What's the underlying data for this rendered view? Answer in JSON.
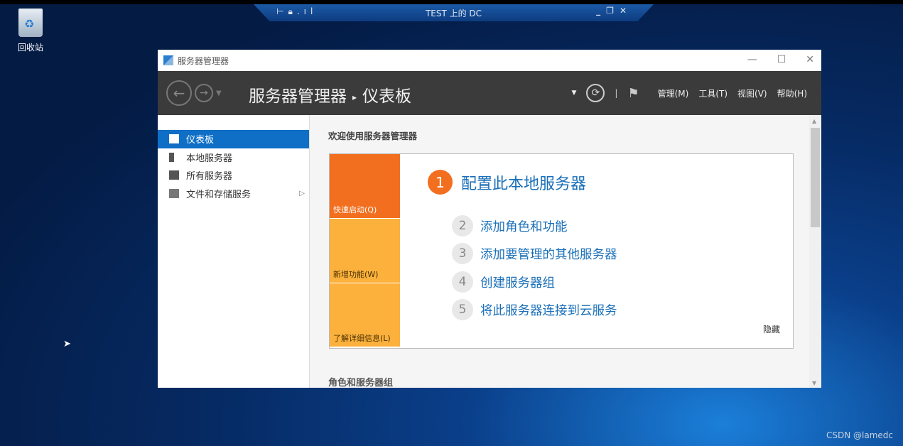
{
  "rdp_bar": {
    "title": "TEST 上的 DC",
    "left_icons": [
      "pin-icon",
      "lock-icon",
      "signal-icon"
    ],
    "right_icons": [
      "minimize-icon",
      "restore-icon",
      "close-icon"
    ]
  },
  "desktop": {
    "recycle_bin": "回收站",
    "watermark": "CSDN @lamedc"
  },
  "window": {
    "title": "服务器管理器",
    "breadcrumb": {
      "root": "服务器管理器",
      "current": "仪表板"
    },
    "menu": [
      "管理(M)",
      "工具(T)",
      "视图(V)",
      "帮助(H)"
    ],
    "sidebar": [
      {
        "label": "仪表板",
        "icon": "dashboard-icon",
        "selected": true
      },
      {
        "label": "本地服务器",
        "icon": "server-icon"
      },
      {
        "label": "所有服务器",
        "icon": "servers-icon"
      },
      {
        "label": "文件和存储服务",
        "icon": "storage-icon",
        "has_arrow": true
      }
    ],
    "welcome": "欢迎使用服务器管理器",
    "tiles": [
      "快速启动(Q)",
      "新增功能(W)",
      "了解详细信息(L)"
    ],
    "steps": [
      {
        "n": "1",
        "label": "配置此本地服务器"
      },
      {
        "n": "2",
        "label": "添加角色和功能"
      },
      {
        "n": "3",
        "label": "添加要管理的其他服务器"
      },
      {
        "n": "4",
        "label": "创建服务器组"
      },
      {
        "n": "5",
        "label": "将此服务器连接到云服务"
      }
    ],
    "hide": "隐藏",
    "roles_heading": "角色和服务器组"
  },
  "colors": {
    "accent": "#0f6fc6",
    "orange": "#f26f1f",
    "amber": "#fbb13c",
    "header": "#3b3b3b"
  }
}
